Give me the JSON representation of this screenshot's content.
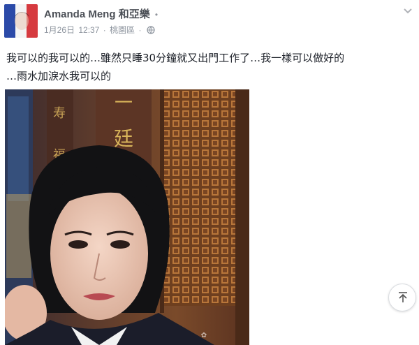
{
  "post": {
    "author_name": "Amanda Meng",
    "with_label": "和",
    "with_friend": "亞樂",
    "date": "1月26日",
    "time": "12:37",
    "location": "桃園區",
    "separator": "·",
    "text_line1": "我可以的我可以的…雖然只睡30分鐘就又出門工作了…我一樣可以做好的",
    "text_line2": "…雨水加淚水我可以的"
  },
  "icons": {
    "avatar": "french-flag-avatar",
    "privacy": "globe-icon",
    "menu": "chevron-down-icon",
    "scroll": "arrow-up-icon"
  },
  "colors": {
    "name": "#4b4f56",
    "meta": "#8d949e",
    "text": "#1d2129"
  }
}
